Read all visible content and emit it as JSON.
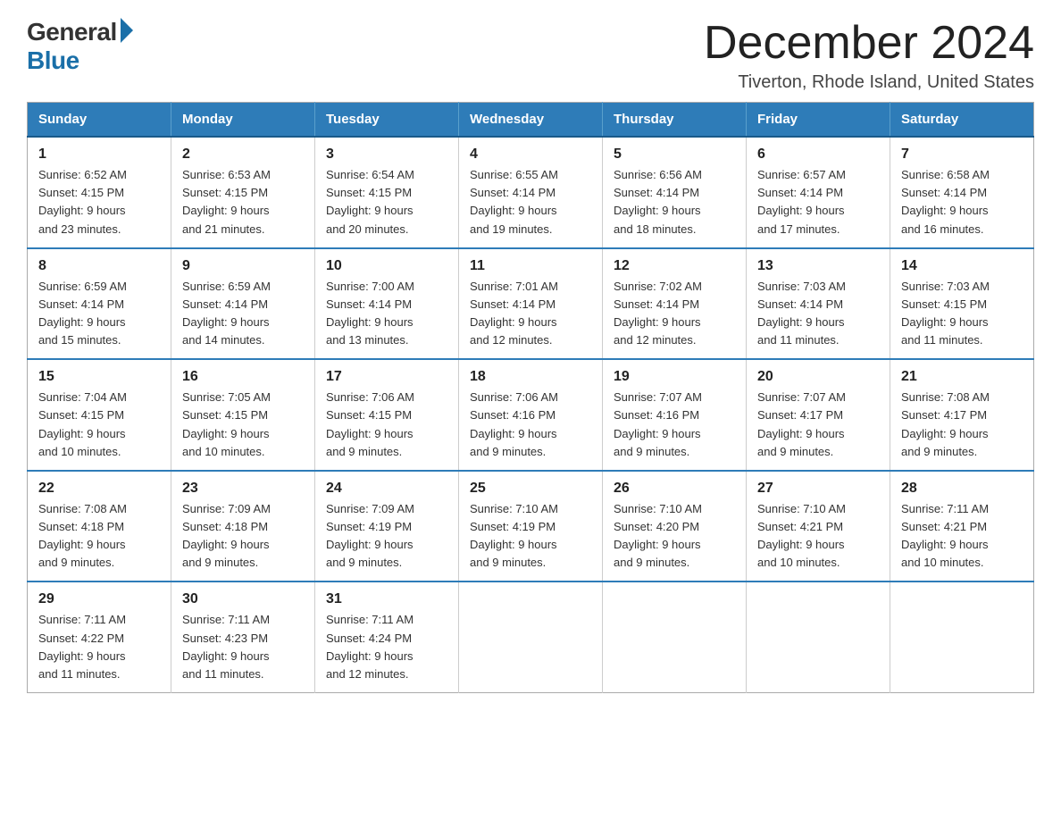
{
  "logo": {
    "general": "General",
    "blue": "Blue"
  },
  "header": {
    "month": "December 2024",
    "location": "Tiverton, Rhode Island, United States"
  },
  "days_of_week": [
    "Sunday",
    "Monday",
    "Tuesday",
    "Wednesday",
    "Thursday",
    "Friday",
    "Saturday"
  ],
  "weeks": [
    [
      {
        "day": "1",
        "sunrise": "6:52 AM",
        "sunset": "4:15 PM",
        "daylight": "9 hours and 23 minutes."
      },
      {
        "day": "2",
        "sunrise": "6:53 AM",
        "sunset": "4:15 PM",
        "daylight": "9 hours and 21 minutes."
      },
      {
        "day": "3",
        "sunrise": "6:54 AM",
        "sunset": "4:15 PM",
        "daylight": "9 hours and 20 minutes."
      },
      {
        "day": "4",
        "sunrise": "6:55 AM",
        "sunset": "4:14 PM",
        "daylight": "9 hours and 19 minutes."
      },
      {
        "day": "5",
        "sunrise": "6:56 AM",
        "sunset": "4:14 PM",
        "daylight": "9 hours and 18 minutes."
      },
      {
        "day": "6",
        "sunrise": "6:57 AM",
        "sunset": "4:14 PM",
        "daylight": "9 hours and 17 minutes."
      },
      {
        "day": "7",
        "sunrise": "6:58 AM",
        "sunset": "4:14 PM",
        "daylight": "9 hours and 16 minutes."
      }
    ],
    [
      {
        "day": "8",
        "sunrise": "6:59 AM",
        "sunset": "4:14 PM",
        "daylight": "9 hours and 15 minutes."
      },
      {
        "day": "9",
        "sunrise": "6:59 AM",
        "sunset": "4:14 PM",
        "daylight": "9 hours and 14 minutes."
      },
      {
        "day": "10",
        "sunrise": "7:00 AM",
        "sunset": "4:14 PM",
        "daylight": "9 hours and 13 minutes."
      },
      {
        "day": "11",
        "sunrise": "7:01 AM",
        "sunset": "4:14 PM",
        "daylight": "9 hours and 12 minutes."
      },
      {
        "day": "12",
        "sunrise": "7:02 AM",
        "sunset": "4:14 PM",
        "daylight": "9 hours and 12 minutes."
      },
      {
        "day": "13",
        "sunrise": "7:03 AM",
        "sunset": "4:14 PM",
        "daylight": "9 hours and 11 minutes."
      },
      {
        "day": "14",
        "sunrise": "7:03 AM",
        "sunset": "4:15 PM",
        "daylight": "9 hours and 11 minutes."
      }
    ],
    [
      {
        "day": "15",
        "sunrise": "7:04 AM",
        "sunset": "4:15 PM",
        "daylight": "9 hours and 10 minutes."
      },
      {
        "day": "16",
        "sunrise": "7:05 AM",
        "sunset": "4:15 PM",
        "daylight": "9 hours and 10 minutes."
      },
      {
        "day": "17",
        "sunrise": "7:06 AM",
        "sunset": "4:15 PM",
        "daylight": "9 hours and 9 minutes."
      },
      {
        "day": "18",
        "sunrise": "7:06 AM",
        "sunset": "4:16 PM",
        "daylight": "9 hours and 9 minutes."
      },
      {
        "day": "19",
        "sunrise": "7:07 AM",
        "sunset": "4:16 PM",
        "daylight": "9 hours and 9 minutes."
      },
      {
        "day": "20",
        "sunrise": "7:07 AM",
        "sunset": "4:17 PM",
        "daylight": "9 hours and 9 minutes."
      },
      {
        "day": "21",
        "sunrise": "7:08 AM",
        "sunset": "4:17 PM",
        "daylight": "9 hours and 9 minutes."
      }
    ],
    [
      {
        "day": "22",
        "sunrise": "7:08 AM",
        "sunset": "4:18 PM",
        "daylight": "9 hours and 9 minutes."
      },
      {
        "day": "23",
        "sunrise": "7:09 AM",
        "sunset": "4:18 PM",
        "daylight": "9 hours and 9 minutes."
      },
      {
        "day": "24",
        "sunrise": "7:09 AM",
        "sunset": "4:19 PM",
        "daylight": "9 hours and 9 minutes."
      },
      {
        "day": "25",
        "sunrise": "7:10 AM",
        "sunset": "4:19 PM",
        "daylight": "9 hours and 9 minutes."
      },
      {
        "day": "26",
        "sunrise": "7:10 AM",
        "sunset": "4:20 PM",
        "daylight": "9 hours and 9 minutes."
      },
      {
        "day": "27",
        "sunrise": "7:10 AM",
        "sunset": "4:21 PM",
        "daylight": "9 hours and 10 minutes."
      },
      {
        "day": "28",
        "sunrise": "7:11 AM",
        "sunset": "4:21 PM",
        "daylight": "9 hours and 10 minutes."
      }
    ],
    [
      {
        "day": "29",
        "sunrise": "7:11 AM",
        "sunset": "4:22 PM",
        "daylight": "9 hours and 11 minutes."
      },
      {
        "day": "30",
        "sunrise": "7:11 AM",
        "sunset": "4:23 PM",
        "daylight": "9 hours and 11 minutes."
      },
      {
        "day": "31",
        "sunrise": "7:11 AM",
        "sunset": "4:24 PM",
        "daylight": "9 hours and 12 minutes."
      },
      null,
      null,
      null,
      null
    ]
  ],
  "labels": {
    "sunrise": "Sunrise:",
    "sunset": "Sunset:",
    "daylight": "Daylight:"
  }
}
